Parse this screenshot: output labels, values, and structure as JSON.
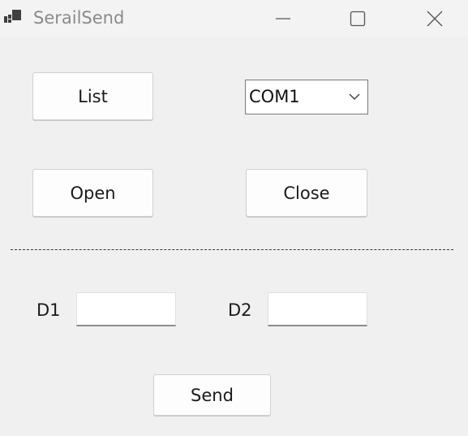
{
  "window": {
    "title": "SerailSend",
    "minimize_icon": "minimize-icon",
    "maximize_icon": "maximize-icon",
    "close_icon": "close-icon"
  },
  "buttons": {
    "list_label": "List",
    "open_label": "Open",
    "close_label": "Close",
    "send_label": "Send"
  },
  "port_select": {
    "selected": "COM1"
  },
  "fields": {
    "d1_label": "D1",
    "d1_value": "",
    "d2_label": "D2",
    "d2_value": ""
  },
  "colors": {
    "background": "#f0f0f0",
    "titlebar": "#f3f3f3",
    "button_face": "#fdfdfd"
  }
}
